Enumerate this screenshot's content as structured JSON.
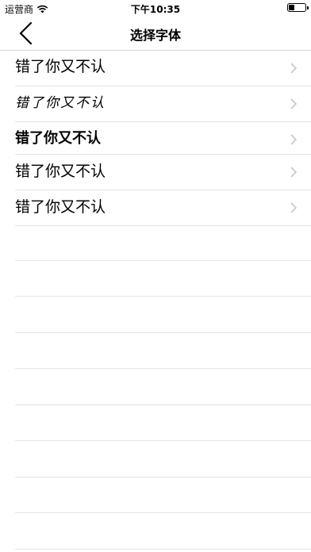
{
  "status_bar": {
    "carrier": "运营商",
    "time": "下午10:35",
    "battery_level": 0.35
  },
  "nav": {
    "title": "选择字体",
    "back_icon": "chevron-left-icon"
  },
  "font_options": [
    {
      "sample": "错了你又不认",
      "icon": "chevron-right-icon"
    },
    {
      "sample": "错了你又不认",
      "icon": "chevron-right-icon"
    },
    {
      "sample": "错了你又不认",
      "icon": "chevron-right-icon"
    },
    {
      "sample": "错了你又不认",
      "icon": "chevron-right-icon"
    },
    {
      "sample": "错了你又不认",
      "icon": "chevron-right-icon"
    }
  ],
  "colors": {
    "text": "#000000",
    "separator": "#e3e3e3",
    "chevron": "#c7c7cc",
    "background": "#ffffff"
  }
}
